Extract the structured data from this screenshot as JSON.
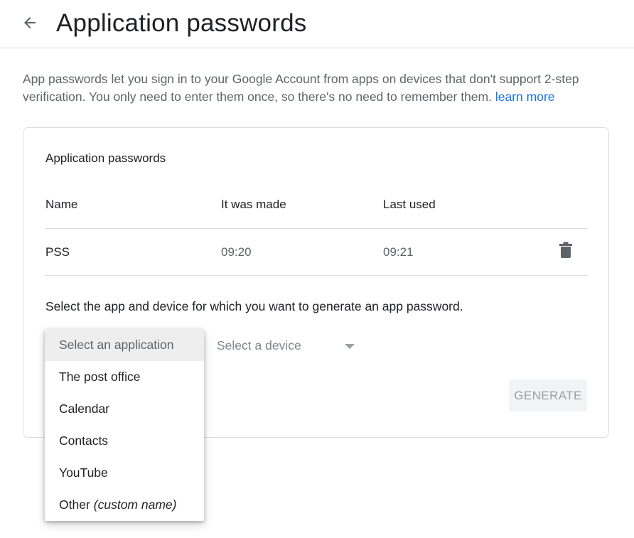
{
  "header": {
    "title": "Application passwords",
    "back_icon": "arrow-left-icon"
  },
  "intro": {
    "text": "App passwords let you sign in to your Google Account from apps on devices that don't support 2-step verification. You only need to enter them once, so there's no need to remember them.",
    "link_label": "learn more"
  },
  "card": {
    "title": "Application passwords",
    "columns": [
      "Name",
      "It was made",
      "Last used"
    ],
    "rows": [
      {
        "name": "PSS",
        "made": "09:20",
        "last_used": "09:21",
        "delete_icon": "trash-icon"
      }
    ],
    "prompt": "Select the app and device for which you want to generate an app password.",
    "device_select": {
      "placeholder": "Select a device",
      "arrow_icon": "caret-down-icon"
    },
    "generate_label": "GENERATE"
  },
  "app_menu": {
    "selected": "Select an application",
    "items": [
      {
        "label": "Select an application",
        "suffix": ""
      },
      {
        "label": "The post office",
        "suffix": ""
      },
      {
        "label": "Calendar",
        "suffix": ""
      },
      {
        "label": "Contacts",
        "suffix": ""
      },
      {
        "label": "YouTube",
        "suffix": ""
      },
      {
        "label": "Other",
        "suffix": "(custom name)"
      }
    ]
  },
  "colors": {
    "link": "#1a73e8",
    "text_primary": "#202124",
    "text_secondary": "#5f6368",
    "divider": "#dadce0",
    "button_disabled_bg": "#f1f3f4"
  }
}
